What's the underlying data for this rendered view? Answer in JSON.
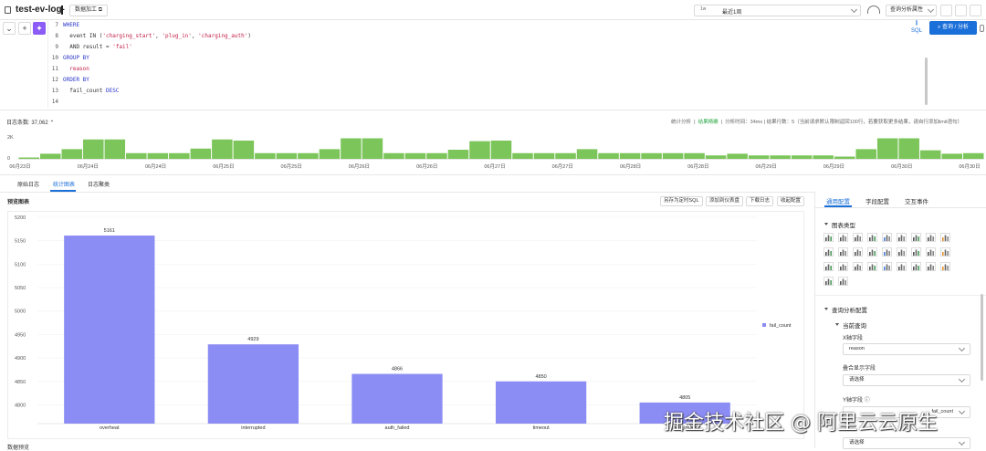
{
  "header": {
    "title": "test-ev-log-",
    "data_process_label": "数据加工",
    "time_tag": "1w",
    "time_value": "最近1周",
    "query_mode": "查询分析属性"
  },
  "editor": {
    "lines": [
      {
        "num": "7",
        "parts": [
          {
            "t": "WHERE",
            "c": "kw"
          }
        ]
      },
      {
        "num": "8",
        "parts": [
          {
            "t": "  event IN (",
            "c": "tx"
          },
          {
            "t": "'charging_start'",
            "c": "str"
          },
          {
            "t": ", ",
            "c": "tx"
          },
          {
            "t": "'plug_in'",
            "c": "str"
          },
          {
            "t": ", ",
            "c": "tx"
          },
          {
            "t": "'charging_auth'",
            "c": "str"
          },
          {
            "t": ")",
            "c": "tx"
          }
        ]
      },
      {
        "num": "9",
        "parts": [
          {
            "t": "  AND result = ",
            "c": "tx"
          },
          {
            "t": "'fail'",
            "c": "str"
          }
        ]
      },
      {
        "num": "10",
        "parts": [
          {
            "t": "GROUP BY",
            "c": "kw"
          }
        ]
      },
      {
        "num": "11",
        "parts": [
          {
            "t": "  reason",
            "c": "str"
          }
        ]
      },
      {
        "num": "12",
        "parts": [
          {
            "t": "ORDER BY",
            "c": "kw"
          }
        ]
      },
      {
        "num": "13",
        "parts": [
          {
            "t": "  fail_count ",
            "c": "tx"
          },
          {
            "t": "DESC",
            "c": "kw"
          }
        ]
      },
      {
        "num": "14",
        "parts": []
      }
    ],
    "sql_label": "SQL",
    "query_button": "查询 / 分析"
  },
  "histogram": {
    "log_count_label": "日志条数: 37,062",
    "stats_prefix": "统计分析",
    "stats_ok": "结果精确",
    "stats_rest": "分析时间：34ms  |  结果行数：5（当前请求默认限制返回100行，若要获取更多结果，请自行添加limit语句）",
    "y_ticks": [
      "2K",
      "0"
    ],
    "x_labels": [
      "06月23日",
      "06月24日",
      "06月24日",
      "06月25日",
      "06月25日",
      "06月26日",
      "06月26日",
      "06月27日",
      "06月27日",
      "06月28日",
      "06月28日",
      "06月29日",
      "06月29日",
      "06月30日",
      "06月30日"
    ],
    "bars": [
      120,
      450,
      850,
      1700,
      1700,
      500,
      500,
      500,
      900,
      1700,
      1600,
      500,
      500,
      500,
      850,
      1800,
      1800,
      500,
      500,
      500,
      800,
      1550,
      1600,
      500,
      500,
      500,
      850,
      500,
      500,
      500,
      500,
      500,
      300,
      450,
      300,
      300,
      300,
      300,
      200,
      850,
      1800,
      1800,
      750,
      450,
      500
    ],
    "bar_max": 2000
  },
  "tabs": [
    "原始日志",
    "统计图表",
    "日志聚类"
  ],
  "preview": {
    "title": "预览图表",
    "actions": [
      "另存为定时SQL",
      "添加到仪表盘",
      "下载日志",
      "收起配置"
    ],
    "bottom_label": "数据预览"
  },
  "chart_data": {
    "type": "bar",
    "categories": [
      "overheat",
      "interrupted",
      "auth_failed",
      "timeout",
      "card_invalid"
    ],
    "series": [
      {
        "name": "fail_count",
        "values": [
          5161,
          4929,
          4866,
          4850,
          4805
        ]
      }
    ],
    "y_ticks": [
      4800,
      4850,
      4900,
      4950,
      5000,
      5050,
      5100,
      5150,
      5200
    ],
    "ylim": [
      4760,
      5200
    ],
    "bar_color": "#8c8cf5",
    "legend_position": "right"
  },
  "config": {
    "tabs": [
      "通用配置",
      "字段配置",
      "交互事件"
    ],
    "chart_type_title": "图表类型",
    "query_config_title": "查询分析配置",
    "current_query_title": "当前查询",
    "x_field_label": "X轴字段",
    "x_field_value": "reason",
    "overlay_label": "叠合显示字段",
    "overlay_placeholder": "请选择",
    "y_field_label": "Y轴字段",
    "y_field_value": "fail_count",
    "extra_placeholder": "请选择"
  },
  "watermark": "掘金技术社区 @ 阿里云云原生"
}
